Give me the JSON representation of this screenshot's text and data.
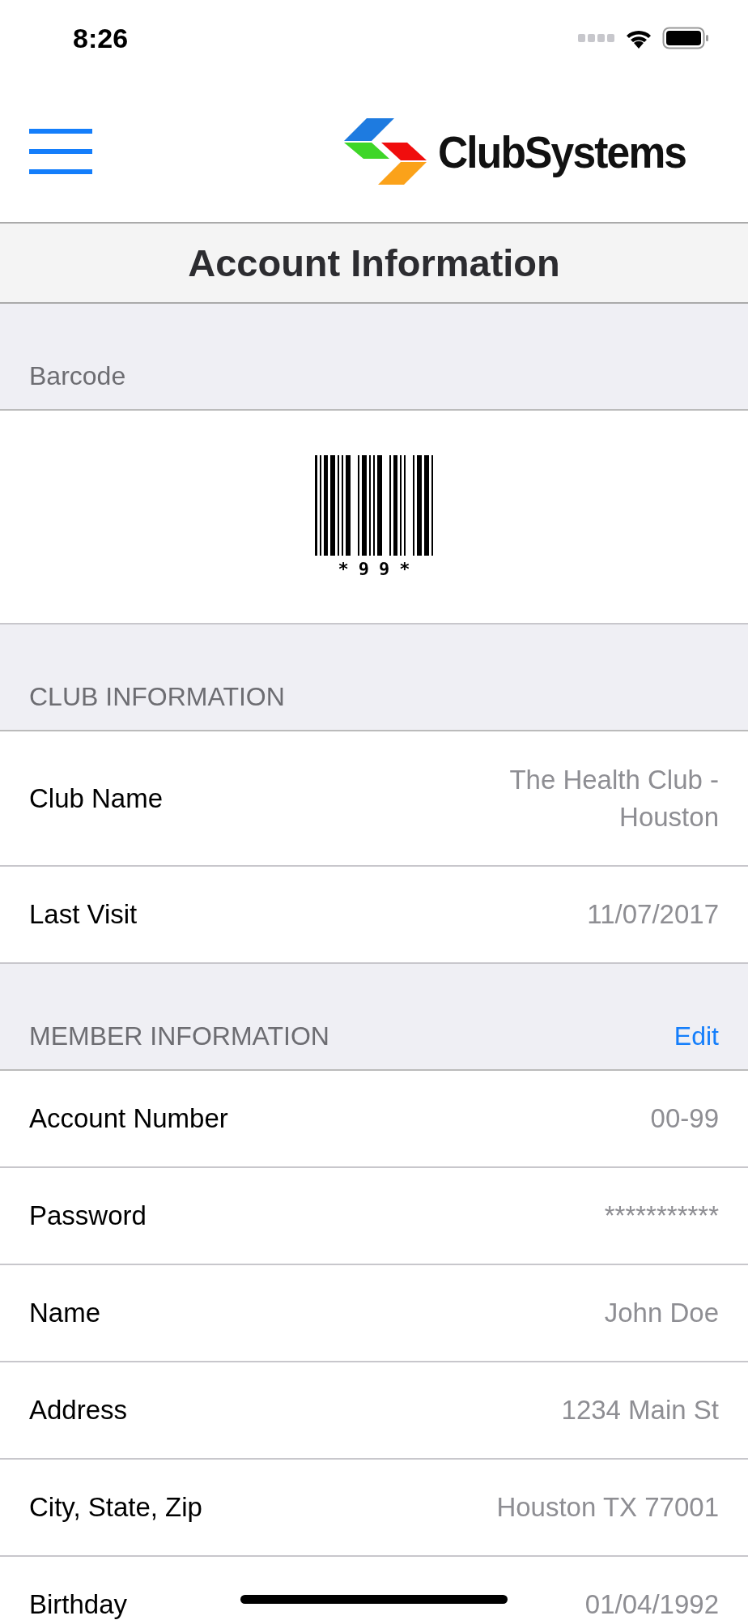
{
  "status_bar": {
    "time": "8:26"
  },
  "nav": {
    "brand": "ClubSystems"
  },
  "title": "Account Information",
  "sections": [
    {
      "kind": "barcode",
      "header": "Barcode",
      "barcode_text": "*99*"
    },
    {
      "kind": "list",
      "header": "CLUB INFORMATION",
      "rows": [
        {
          "label": "Club Name",
          "value": "The Health Club - Houston"
        },
        {
          "label": "Last Visit",
          "value": "11/07/2017"
        }
      ]
    },
    {
      "kind": "list",
      "header": "MEMBER INFORMATION",
      "action": "Edit",
      "rows": [
        {
          "label": "Account Number",
          "value": "00-99"
        },
        {
          "label": "Password",
          "value": "***********"
        },
        {
          "label": "Name",
          "value": "John Doe"
        },
        {
          "label": "Address",
          "value": "1234 Main St"
        },
        {
          "label": "City, State, Zip",
          "value": "Houston TX 77001"
        },
        {
          "label": "Birthday",
          "value": "01/04/1992"
        }
      ]
    }
  ]
}
